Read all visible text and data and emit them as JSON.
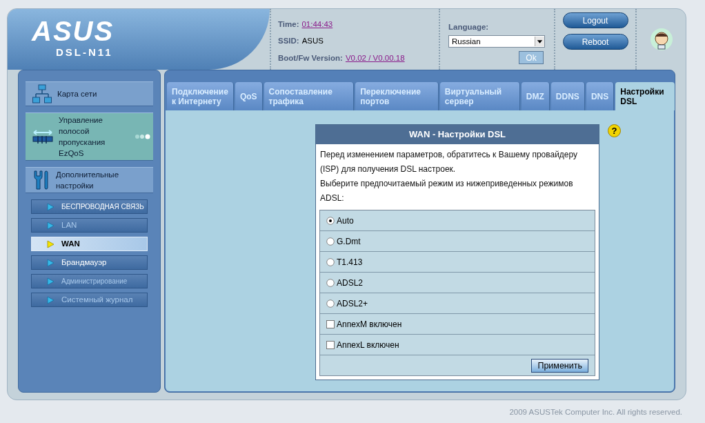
{
  "header": {
    "logo": "ASUS",
    "model": "DSL-N11",
    "time_label": "Time:",
    "time": "01:44:43",
    "ssid_label": "SSID:",
    "ssid": "ASUS",
    "fw_label": "Boot/Fw Version:",
    "fw": "V0.02 / V0.00.18",
    "language_label": "Language:",
    "language": "Russian",
    "ok_button": "Ok",
    "buttons": [
      "Logout",
      "Reboot"
    ]
  },
  "sidebar": {
    "main_items": [
      {
        "label": "Карта сети",
        "kind": "network",
        "highlighted": false
      },
      {
        "label": "Управление полосой пропускания EzQoS",
        "kind": "qos",
        "highlighted": true
      },
      {
        "label": "Дополнительные настройки",
        "kind": "tools",
        "highlighted": false
      }
    ],
    "sub_items": [
      {
        "label": "БЕСПРОВОДНАЯ СВЯЗЬ",
        "selected": false,
        "dimmed": false
      },
      {
        "label": "LAN",
        "selected": false,
        "dimmed": true
      },
      {
        "label": "WAN",
        "selected": true,
        "dimmed": false
      },
      {
        "label": "Брандмауэр",
        "selected": false,
        "dimmed": false
      },
      {
        "label": "Администрирование",
        "selected": false,
        "dimmed": true
      },
      {
        "label": "Системный журнал",
        "selected": false,
        "dimmed": true
      }
    ]
  },
  "tabs": [
    {
      "label": "Подключение к Интернету",
      "selected": false
    },
    {
      "label": "QoS",
      "selected": false
    },
    {
      "label": "Сопоставление трафика",
      "selected": false
    },
    {
      "label": "Переключение портов",
      "selected": false
    },
    {
      "label": "Виртуальный сервер",
      "selected": false
    },
    {
      "label": "DMZ",
      "selected": false
    },
    {
      "label": "DDNS",
      "selected": false
    },
    {
      "label": "DNS",
      "selected": false
    },
    {
      "label": "Настройки DSL",
      "selected": true
    }
  ],
  "panel": {
    "title": "WAN - Настройки DSL",
    "description": [
      "Перед изменением параметров, обратитесь к Вашему провайдеру (ISP) для получения DSL настроек.",
      "Выберите предпочитаемый режим из нижеприведенных режимов ADSL:"
    ],
    "options": [
      {
        "kind": "radio",
        "label": "Auto",
        "selected": true
      },
      {
        "kind": "radio",
        "label": "G.Dmt",
        "selected": false
      },
      {
        "kind": "radio",
        "label": "T1.413",
        "selected": false
      },
      {
        "kind": "radio",
        "label": "ADSL2",
        "selected": false
      },
      {
        "kind": "radio",
        "label": "ADSL2+",
        "selected": false
      },
      {
        "kind": "checkbox",
        "label": "AnnexM включен",
        "checked": false
      },
      {
        "kind": "checkbox",
        "label": "AnnexL включен",
        "checked": false
      }
    ],
    "apply_button": "Применить",
    "help": "?"
  },
  "footer": "2009 ASUSTek Computer Inc. All rights reserved."
}
